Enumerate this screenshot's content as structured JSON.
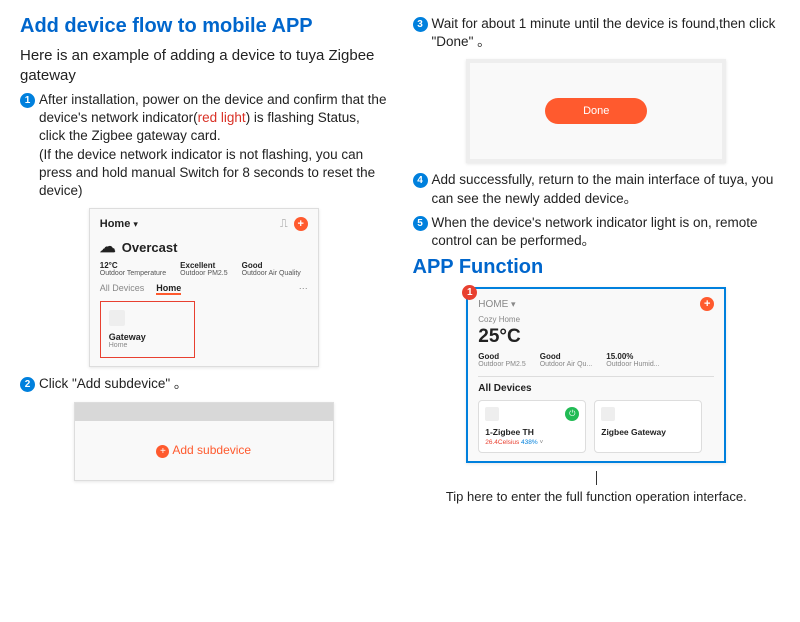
{
  "left": {
    "heading": "Add device flow to mobile APP",
    "intro": "Here is an example of adding a device to tuya Zigbee gateway",
    "step1a": "After installation, power on the device and confirm that the device's network indicator(",
    "step1_red": "red light",
    "step1b": ") is flashing Status, click the Zigbee gateway card.",
    "step1c": "(If the device network indicator is not flashing, you can press and hold manual Switch for 8 seconds to reset the device)",
    "step2": "Click  \"Add subdevice\" 。"
  },
  "mock1": {
    "home": "Home",
    "weather": "Overcast",
    "temp": "12°C",
    "temp_label": "Outdoor Temperature",
    "q1": "Excellent",
    "q1l": "Outdoor PM2.5",
    "q2": "Good",
    "q2l": "Outdoor Air Quality",
    "tab_all": "All Devices",
    "tab_home": "Home",
    "card_title": "Gateway",
    "card_sub": "Home"
  },
  "mock2": {
    "label": "Add subdevice"
  },
  "right": {
    "step3": "Wait for about 1 minute until the device is found,then click  \"Done\" 。",
    "step4": "Add successfully, return to the main interface of tuya, you can see the newly added device。",
    "step5": "When the device's network indicator light is on, remote control can be performed。",
    "heading2": "APP Function",
    "tip": "Tip here to enter the full function operation interface."
  },
  "mock3": {
    "done": "Done"
  },
  "mock4": {
    "home": "HOME",
    "home_name": "Cozy Home",
    "temp": "25°C",
    "s1": "Good",
    "s1l": "Outdoor PM2.5",
    "s2": "Good",
    "s2l": "Outdoor Air Qu...",
    "s3": "15.00%",
    "s3l": "Outdoor Humid...",
    "all": "All Devices",
    "c1_title": "1-Zigbee TH",
    "c1_sub_r": "26.4Celsius",
    "c1_sub_b": "438%",
    "c2_title": "Zigbee  Gateway"
  }
}
